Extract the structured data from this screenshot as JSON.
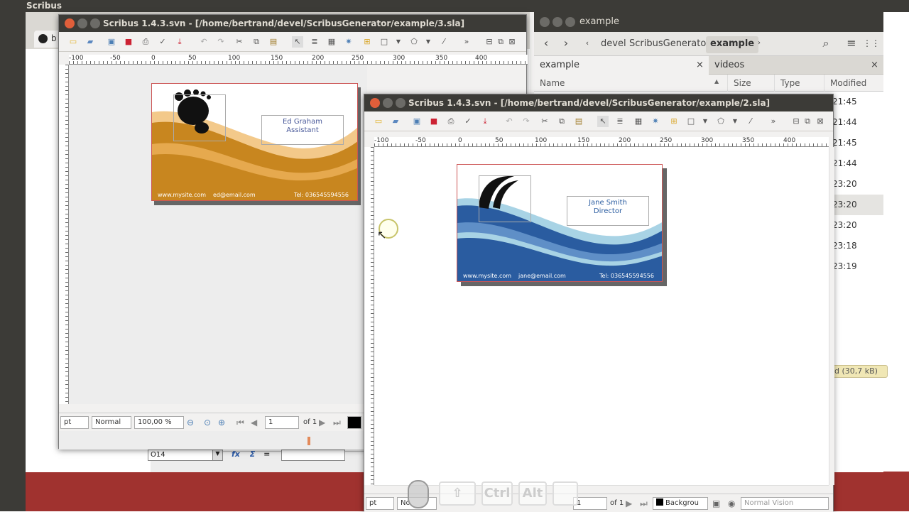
{
  "topbar": {
    "app_name": "Scribus"
  },
  "browser": {
    "tab_label": "b",
    "cell_ref": "O14",
    "fx_label": "fx",
    "sigma_label": "Σ",
    "equals_label": "="
  },
  "files": {
    "title": "example",
    "crumbs": [
      "devel",
      "ScribusGenerator",
      "example"
    ],
    "tabs": [
      "example",
      "videos"
    ],
    "close_glyph": "×",
    "columns": [
      "Name",
      "Size",
      "Type",
      "Modified"
    ],
    "modified": [
      "21:45",
      "21:44",
      "21:45",
      "21:44",
      "23:20",
      "23:20",
      "23:20",
      "23:18",
      "23:19"
    ],
    "status_text": "d (30,7 kB)"
  },
  "scribus_back": {
    "title": "Scribus 1.4.3.svn - [/home/bertrand/devel/ScribusGenerator/example/3.sla]",
    "ruler_h": [
      "-100",
      "-50",
      "0",
      "50",
      "100",
      "150",
      "200",
      "250",
      "300",
      "350",
      "400"
    ],
    "card": {
      "name": "Ed Graham",
      "role": "Assistant",
      "site": "www.mysite.com",
      "email": "ed@email.com",
      "tel": "Tel: 036545594556"
    },
    "status": {
      "unit": "pt",
      "mode": "Normal",
      "zoom": "100,00 %",
      "page": "1",
      "of": "of 1"
    },
    "colors": {
      "wave_dark": "#c8861f",
      "wave_light": "#f3c98a",
      "wave_mid": "#e6a94e"
    }
  },
  "scribus_front": {
    "title": "Scribus 1.4.3.svn - [/home/bertrand/devel/ScribusGenerator/example/2.sla]",
    "ruler_h": [
      "-100",
      "-50",
      "0",
      "50",
      "100",
      "150",
      "200",
      "250",
      "300",
      "350",
      "400"
    ],
    "card": {
      "name": "Jane Smith",
      "role": "Director",
      "site": "www.mysite.com",
      "email": "jane@email.com",
      "tel": "Tel: 036545594556"
    },
    "status": {
      "unit": "pt",
      "mode": "No",
      "page": "1",
      "of": "of 1",
      "layer": "Backgrou",
      "vision": "Normal Vision"
    },
    "colors": {
      "wave_dark": "#2a5ca0",
      "wave_light": "#a8d3e5",
      "wave_mid": "#5f8fc7"
    }
  },
  "keyhints": [
    "Ctrl",
    "Alt"
  ]
}
